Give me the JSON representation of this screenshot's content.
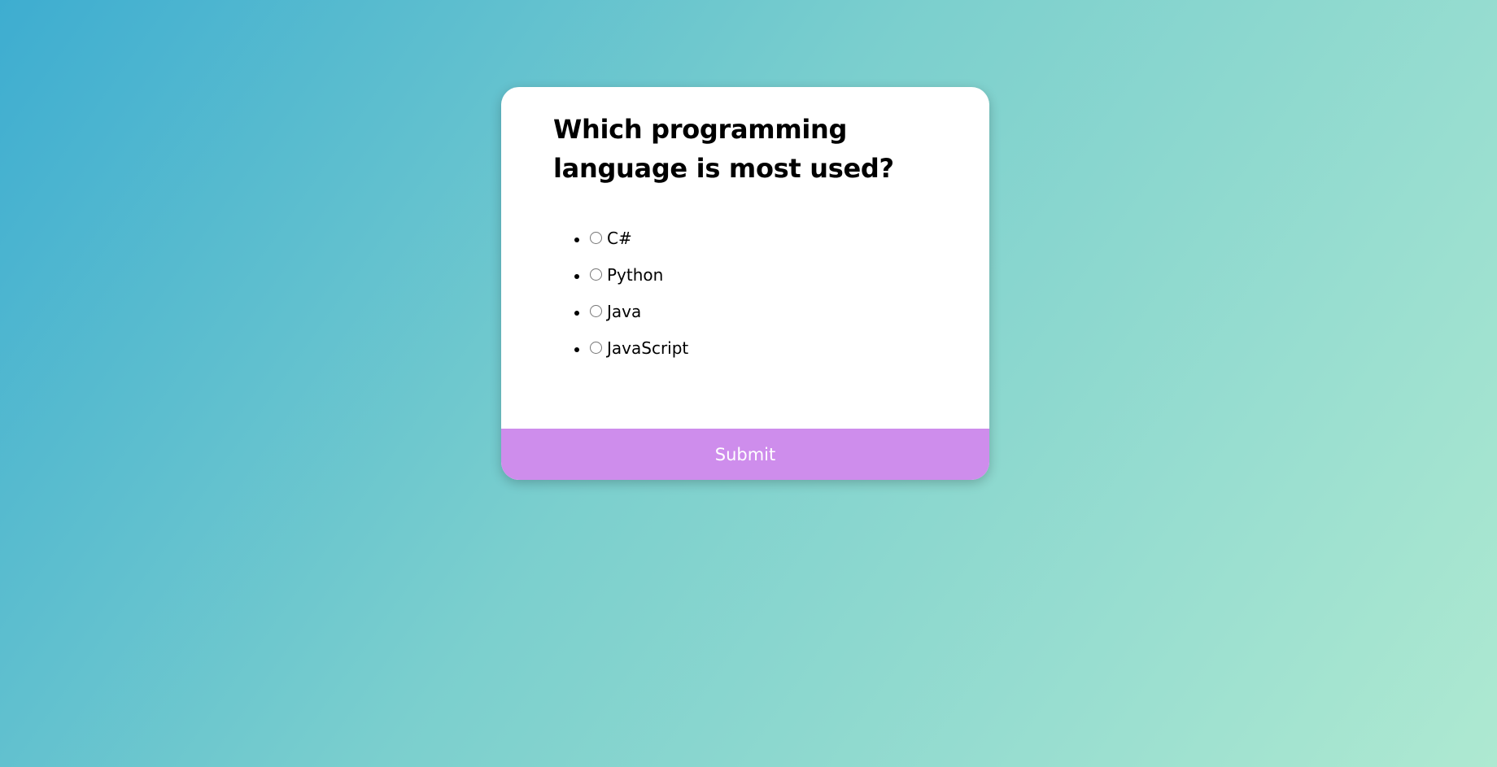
{
  "quiz": {
    "question": "Which programming language is most used?",
    "answers": [
      {
        "id": "a",
        "label": "C#"
      },
      {
        "id": "b",
        "label": "Python"
      },
      {
        "id": "c",
        "label": "Java"
      },
      {
        "id": "d",
        "label": "JavaScript"
      }
    ],
    "submit_label": "Submit"
  },
  "colors": {
    "background_gradient_start": "#3eadd0",
    "background_gradient_end": "#aee9d1",
    "card": "#ffffff",
    "submit_button": "#ce8dec",
    "submit_text": "#ffffff"
  }
}
